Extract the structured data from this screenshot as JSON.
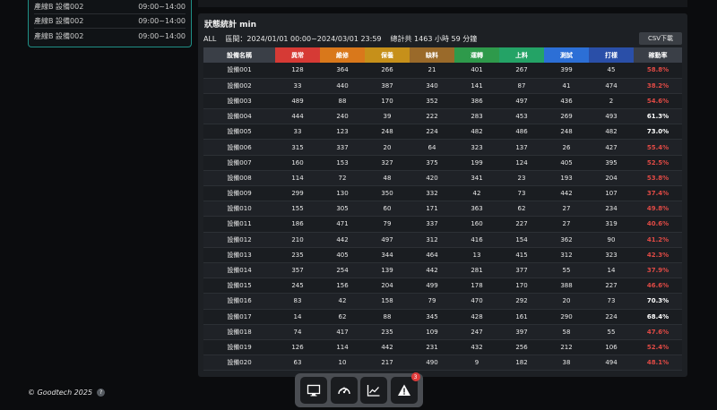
{
  "schedule": [
    {
      "name": "產線B 設備002",
      "time": "09:00~14:00"
    },
    {
      "name": "產線B 設備002",
      "time": "09:00~14:00"
    },
    {
      "name": "產線B 設備002",
      "time": "09:00~14:00"
    }
  ],
  "panel": {
    "title": "狀態統計 min",
    "filter": "ALL",
    "period": "區間：2024/01/01 00:00~2024/03/01 23:59",
    "total": "總計共 1463 小時 59 分鐘",
    "csv_label": "CSV下載"
  },
  "table": {
    "headers": [
      "設備名稱",
      "異常",
      "維修",
      "保養",
      "缺料",
      "運轉",
      "上料",
      "測試",
      "打樣",
      "稼動率"
    ],
    "rows": [
      [
        "設備001",
        "128",
        "364",
        "266",
        "21",
        "401",
        "267",
        "399",
        "45",
        "58.8%"
      ],
      [
        "設備002",
        "33",
        "440",
        "387",
        "340",
        "141",
        "87",
        "41",
        "474",
        "38.2%"
      ],
      [
        "設備003",
        "489",
        "88",
        "170",
        "352",
        "386",
        "497",
        "436",
        "2",
        "54.6%"
      ],
      [
        "設備004",
        "444",
        "240",
        "39",
        "222",
        "283",
        "453",
        "269",
        "493",
        "61.3%"
      ],
      [
        "設備005",
        "33",
        "123",
        "248",
        "224",
        "482",
        "486",
        "248",
        "482",
        "73.0%"
      ],
      [
        "設備006",
        "315",
        "337",
        "20",
        "64",
        "323",
        "137",
        "26",
        "427",
        "55.4%"
      ],
      [
        "設備007",
        "160",
        "153",
        "327",
        "375",
        "199",
        "124",
        "405",
        "395",
        "52.5%"
      ],
      [
        "設備008",
        "114",
        "72",
        "48",
        "420",
        "341",
        "23",
        "193",
        "204",
        "53.8%"
      ],
      [
        "設備009",
        "299",
        "130",
        "350",
        "332",
        "42",
        "73",
        "442",
        "107",
        "37.4%"
      ],
      [
        "設備010",
        "155",
        "305",
        "60",
        "171",
        "363",
        "62",
        "27",
        "234",
        "49.8%"
      ],
      [
        "設備011",
        "186",
        "471",
        "79",
        "337",
        "160",
        "227",
        "27",
        "319",
        "40.6%"
      ],
      [
        "設備012",
        "210",
        "442",
        "497",
        "312",
        "416",
        "154",
        "362",
        "90",
        "41.2%"
      ],
      [
        "設備013",
        "235",
        "405",
        "344",
        "464",
        "13",
        "415",
        "312",
        "323",
        "42.3%"
      ],
      [
        "設備014",
        "357",
        "254",
        "139",
        "442",
        "281",
        "377",
        "55",
        "14",
        "37.9%"
      ],
      [
        "設備015",
        "245",
        "156",
        "204",
        "499",
        "178",
        "170",
        "388",
        "227",
        "46.6%"
      ],
      [
        "設備016",
        "83",
        "42",
        "158",
        "79",
        "470",
        "292",
        "20",
        "73",
        "70.3%"
      ],
      [
        "設備017",
        "14",
        "62",
        "88",
        "345",
        "428",
        "161",
        "290",
        "224",
        "68.4%"
      ],
      [
        "設備018",
        "74",
        "417",
        "235",
        "109",
        "247",
        "397",
        "58",
        "55",
        "47.6%"
      ],
      [
        "設備019",
        "126",
        "114",
        "442",
        "231",
        "432",
        "256",
        "212",
        "106",
        "52.4%"
      ],
      [
        "設備020",
        "63",
        "10",
        "217",
        "490",
        "9",
        "182",
        "38",
        "494",
        "48.1%"
      ]
    ],
    "high_rate_rows": [
      3,
      4,
      15,
      16
    ]
  },
  "footer": {
    "copyright": "© Goodtech 2025",
    "help": "?"
  },
  "dock": {
    "alert_count": "3",
    "icons": [
      "monitor-icon",
      "gauge-icon",
      "chart-icon",
      "warning-icon"
    ]
  }
}
